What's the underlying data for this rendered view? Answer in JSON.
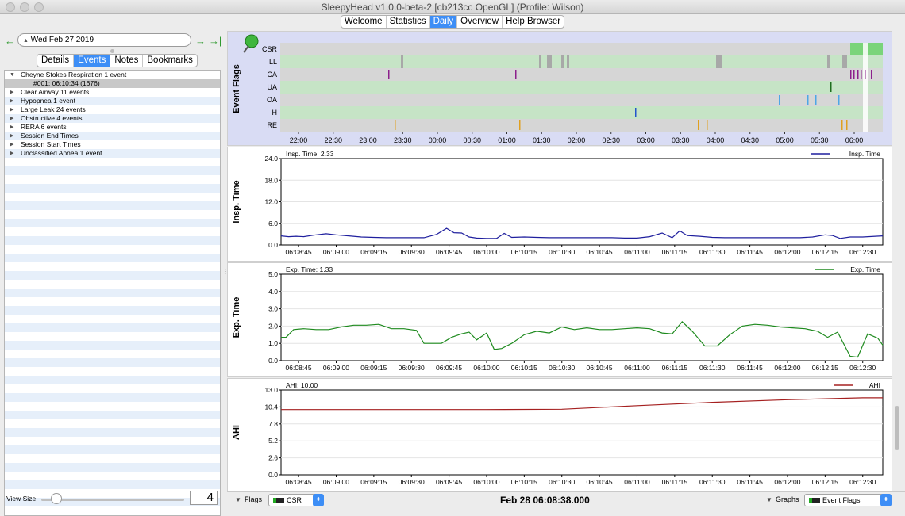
{
  "window": {
    "title": "SleepyHead v1.0.0-beta-2 [cb213cc OpenGL] (Profile: Wilson)"
  },
  "top_tabs": [
    {
      "label": "Welcome",
      "active": false
    },
    {
      "label": "Statistics",
      "active": false
    },
    {
      "label": "Daily",
      "active": true
    },
    {
      "label": "Overview",
      "active": false
    },
    {
      "label": "Help Browser",
      "active": false
    }
  ],
  "date_nav": {
    "prev_icon": "arrow-left-icon",
    "date": "Wed Feb 27 2019",
    "next_icon": "arrow-right-icon",
    "last_icon": "arrow-to-end-icon"
  },
  "sub_tabs": [
    {
      "label": "Details",
      "active": false
    },
    {
      "label": "Events",
      "active": true
    },
    {
      "label": "Notes",
      "active": false
    },
    {
      "label": "Bookmarks",
      "active": false
    }
  ],
  "events": [
    {
      "label": "Cheyne Stokes Respiration 1 event",
      "expanded": true
    },
    {
      "label": "#001: 06:10:34 (1676)",
      "child": true
    },
    {
      "label": "Clear Airway 11 events"
    },
    {
      "label": "Hypopnea 1 event"
    },
    {
      "label": "Large Leak 24 events"
    },
    {
      "label": "Obstructive 4 events"
    },
    {
      "label": "RERA 6 events"
    },
    {
      "label": "Session End Times"
    },
    {
      "label": "Session Start Times"
    },
    {
      "label": "Unclassified Apnea 1 event"
    }
  ],
  "view_size": {
    "label": "View Size",
    "value": "4"
  },
  "event_flags": {
    "ylabel": "Event Flags",
    "rows": [
      "CSR",
      "LL",
      "CA",
      "UA",
      "OA",
      "H",
      "RE"
    ],
    "time_ticks": [
      "22:00",
      "22:30",
      "23:00",
      "23:30",
      "00:00",
      "00:30",
      "01:00",
      "01:30",
      "02:00",
      "02:30",
      "03:00",
      "03:30",
      "04:00",
      "04:30",
      "05:00",
      "05:30",
      "06:00"
    ]
  },
  "charts": [
    {
      "id": "insp",
      "ylabel": "Insp. Time",
      "readout": "Insp. Time: 2.33",
      "legend": "Insp. Time",
      "color": "#1f1f9e",
      "yticks": [
        "24.0",
        "18.0",
        "12.0",
        "6.0",
        "0.0"
      ],
      "ylim": [
        0,
        24
      ]
    },
    {
      "id": "exp",
      "ylabel": "Exp. Time",
      "readout": "Exp. Time: 1.33",
      "legend": "Exp. Time",
      "color": "#1e8a1e",
      "yticks": [
        "5.0",
        "4.0",
        "3.0",
        "2.0",
        "1.0",
        "0.0"
      ],
      "ylim": [
        0,
        5
      ]
    },
    {
      "id": "ahi",
      "ylabel": "AHI",
      "readout": "AHI: 10.00",
      "legend": "AHI",
      "color": "#a52020",
      "yticks": [
        "13.0",
        "10.4",
        "7.8",
        "5.2",
        "2.6",
        "0.0"
      ],
      "ylim": [
        0,
        13
      ]
    }
  ],
  "xticks": [
    "06:08:45",
    "06:09:00",
    "06:09:15",
    "06:09:30",
    "06:09:45",
    "06:10:00",
    "06:10:15",
    "06:10:30",
    "06:10:45",
    "06:11:00",
    "06:11:15",
    "06:11:30",
    "06:11:45",
    "06:12:00",
    "06:12:15",
    "06:12:30"
  ],
  "chart_data": [
    {
      "type": "line",
      "title": "",
      "ylabel": "Insp. Time",
      "ylim": [
        0,
        24
      ],
      "x": [
        "06:08:38",
        "06:08:41",
        "06:08:44",
        "06:08:47",
        "06:08:51",
        "06:08:56",
        "06:09:00",
        "06:09:05",
        "06:09:10",
        "06:09:15",
        "06:09:20",
        "06:09:25",
        "06:09:30",
        "06:09:35",
        "06:09:40",
        "06:09:44",
        "06:09:47",
        "06:09:50",
        "06:09:53",
        "06:09:56",
        "06:10:00",
        "06:10:04",
        "06:10:07",
        "06:10:10",
        "06:10:15",
        "06:10:20",
        "06:10:25",
        "06:10:30",
        "06:10:35",
        "06:10:40",
        "06:10:45",
        "06:10:50",
        "06:10:55",
        "06:11:00",
        "06:11:05",
        "06:11:10",
        "06:11:14",
        "06:11:17",
        "06:11:20",
        "06:11:25",
        "06:11:30",
        "06:11:35",
        "06:11:40",
        "06:11:45",
        "06:11:50",
        "06:11:55",
        "06:12:00",
        "06:12:05",
        "06:12:10",
        "06:12:15",
        "06:12:18",
        "06:12:21",
        "06:12:25",
        "06:12:30",
        "06:12:35",
        "06:12:38"
      ],
      "series": [
        {
          "name": "Insp. Time",
          "values": [
            2.5,
            2.3,
            2.4,
            2.3,
            2.7,
            3.1,
            2.8,
            2.5,
            2.2,
            2.1,
            2.0,
            2.0,
            2.0,
            2.0,
            2.9,
            4.6,
            3.4,
            3.3,
            2.2,
            1.9,
            1.8,
            1.8,
            3.2,
            2.1,
            2.2,
            2.1,
            2.0,
            2.0,
            2.0,
            2.0,
            2.0,
            2.0,
            1.9,
            1.9,
            2.3,
            3.3,
            2.0,
            3.9,
            2.6,
            2.4,
            2.1,
            2.0,
            2.0,
            2.0,
            2.0,
            2.0,
            2.0,
            2.0,
            2.2,
            2.8,
            2.6,
            1.8,
            2.2,
            2.2,
            2.4,
            2.5
          ]
        }
      ]
    },
    {
      "type": "line",
      "title": "",
      "ylabel": "Exp. Time",
      "ylim": [
        0,
        5
      ],
      "x": [
        "06:08:38",
        "06:08:40",
        "06:08:43",
        "06:08:47",
        "06:08:52",
        "06:08:57",
        "06:09:02",
        "06:09:07",
        "06:09:12",
        "06:09:17",
        "06:09:22",
        "06:09:27",
        "06:09:32",
        "06:09:35",
        "06:09:38",
        "06:09:42",
        "06:09:46",
        "06:09:50",
        "06:09:53",
        "06:09:56",
        "06:10:00",
        "06:10:03",
        "06:10:06",
        "06:10:10",
        "06:10:15",
        "06:10:20",
        "06:10:25",
        "06:10:30",
        "06:10:35",
        "06:10:40",
        "06:10:45",
        "06:10:50",
        "06:10:55",
        "06:11:00",
        "06:11:05",
        "06:11:10",
        "06:11:14",
        "06:11:18",
        "06:11:22",
        "06:11:27",
        "06:11:32",
        "06:11:37",
        "06:11:42",
        "06:11:47",
        "06:11:52",
        "06:11:57",
        "06:12:02",
        "06:12:07",
        "06:12:12",
        "06:12:16",
        "06:12:20",
        "06:12:25",
        "06:12:28",
        "06:12:32",
        "06:12:36",
        "06:12:38"
      ],
      "series": [
        {
          "name": "Exp. Time",
          "values": [
            1.35,
            1.35,
            1.8,
            1.85,
            1.8,
            1.8,
            1.95,
            2.05,
            2.05,
            2.1,
            1.85,
            1.85,
            1.75,
            1.0,
            1.0,
            1.0,
            1.35,
            1.55,
            1.65,
            1.2,
            1.6,
            0.65,
            0.7,
            1.0,
            1.5,
            1.7,
            1.6,
            1.95,
            1.8,
            1.9,
            1.8,
            1.8,
            1.85,
            1.9,
            1.85,
            1.6,
            1.55,
            2.25,
            1.7,
            0.85,
            0.85,
            1.5,
            2.0,
            2.1,
            2.05,
            1.95,
            1.9,
            1.85,
            1.7,
            1.35,
            1.65,
            0.25,
            0.2,
            1.55,
            1.3,
            0.9
          ]
        }
      ]
    },
    {
      "type": "line",
      "title": "",
      "ylabel": "AHI",
      "ylim": [
        0,
        13
      ],
      "x": [
        "06:08:38",
        "06:09:00",
        "06:09:30",
        "06:10:00",
        "06:10:30",
        "06:11:00",
        "06:11:30",
        "06:12:00",
        "06:12:30",
        "06:12:38"
      ],
      "series": [
        {
          "name": "AHI",
          "values": [
            10.0,
            10.0,
            10.0,
            10.0,
            10.05,
            10.6,
            11.1,
            11.5,
            11.8,
            11.8
          ]
        }
      ]
    }
  ],
  "bottom": {
    "flags_label": "Flags",
    "flags_value": "CSR",
    "timestamp": "Feb 28 06:08:38.000",
    "graphs_label": "Graphs",
    "graphs_value": "Event Flags"
  }
}
